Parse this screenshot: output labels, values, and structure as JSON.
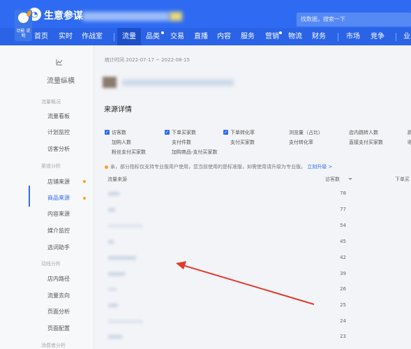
{
  "header": {
    "brand": "生意参谋",
    "search_placeholder": "找数据，搜索一下"
  },
  "nav": {
    "items": [
      "首页",
      "实时",
      "作战室",
      "流量",
      "品类",
      "交易",
      "直播",
      "内容",
      "服务",
      "营销",
      "物流",
      "财务",
      "市场",
      "竞争",
      "业"
    ],
    "active": "流量"
  },
  "sidebar": {
    "mascot_text": "功能 说明",
    "title": "流量纵横",
    "sections": [
      {
        "label": "流量概况",
        "items": [
          "流量看板",
          "计划监控",
          "访客分析"
        ]
      },
      {
        "label": "渠道分析",
        "items": [
          "店铺来源",
          "商品来源",
          "内容来源",
          "媒介监控",
          "选词助手"
        ]
      },
      {
        "label": "动线分析",
        "items": [
          "店内路径",
          "流量去向",
          "页面分析",
          "页面配置"
        ]
      },
      {
        "label": "消费者分析",
        "items": []
      }
    ],
    "active_item": "商品来源"
  },
  "main": {
    "stat_range": "统计时间 2022-07-17 ~ 2022-08-15",
    "section_title": "来源详情",
    "metrics_checked": [
      "访客数",
      "下单买家数",
      "下单转化率"
    ],
    "metrics": [
      "浏览量（占比）",
      "店内跳转人数",
      "跳",
      "加购人数",
      "支付件数",
      "支付买家数",
      "支付转化率",
      "直接支付买家数",
      "收",
      "粉丝支付买家数",
      "加购商品-支付买家数"
    ],
    "notice_text": "亲，部分指标仅支持专业版用户使用，您当前使用的是标准版，如需使用请升级为专业版。",
    "notice_link": "立刻升级 >",
    "table": {
      "col_source": "流量来源",
      "col_visitors": "访客数",
      "col_buyers": "下单买",
      "visitors": [
        "78",
        "77",
        "54",
        "45",
        "42",
        "39",
        "26",
        "25",
        "24",
        "23"
      ]
    }
  },
  "colors": {
    "topbar": "#2f6bf2",
    "nav": "#2a63e6",
    "accent": "#2f6bf2",
    "badge_dot": "#f5a623",
    "annotation_arrow": "#e03a2c"
  }
}
